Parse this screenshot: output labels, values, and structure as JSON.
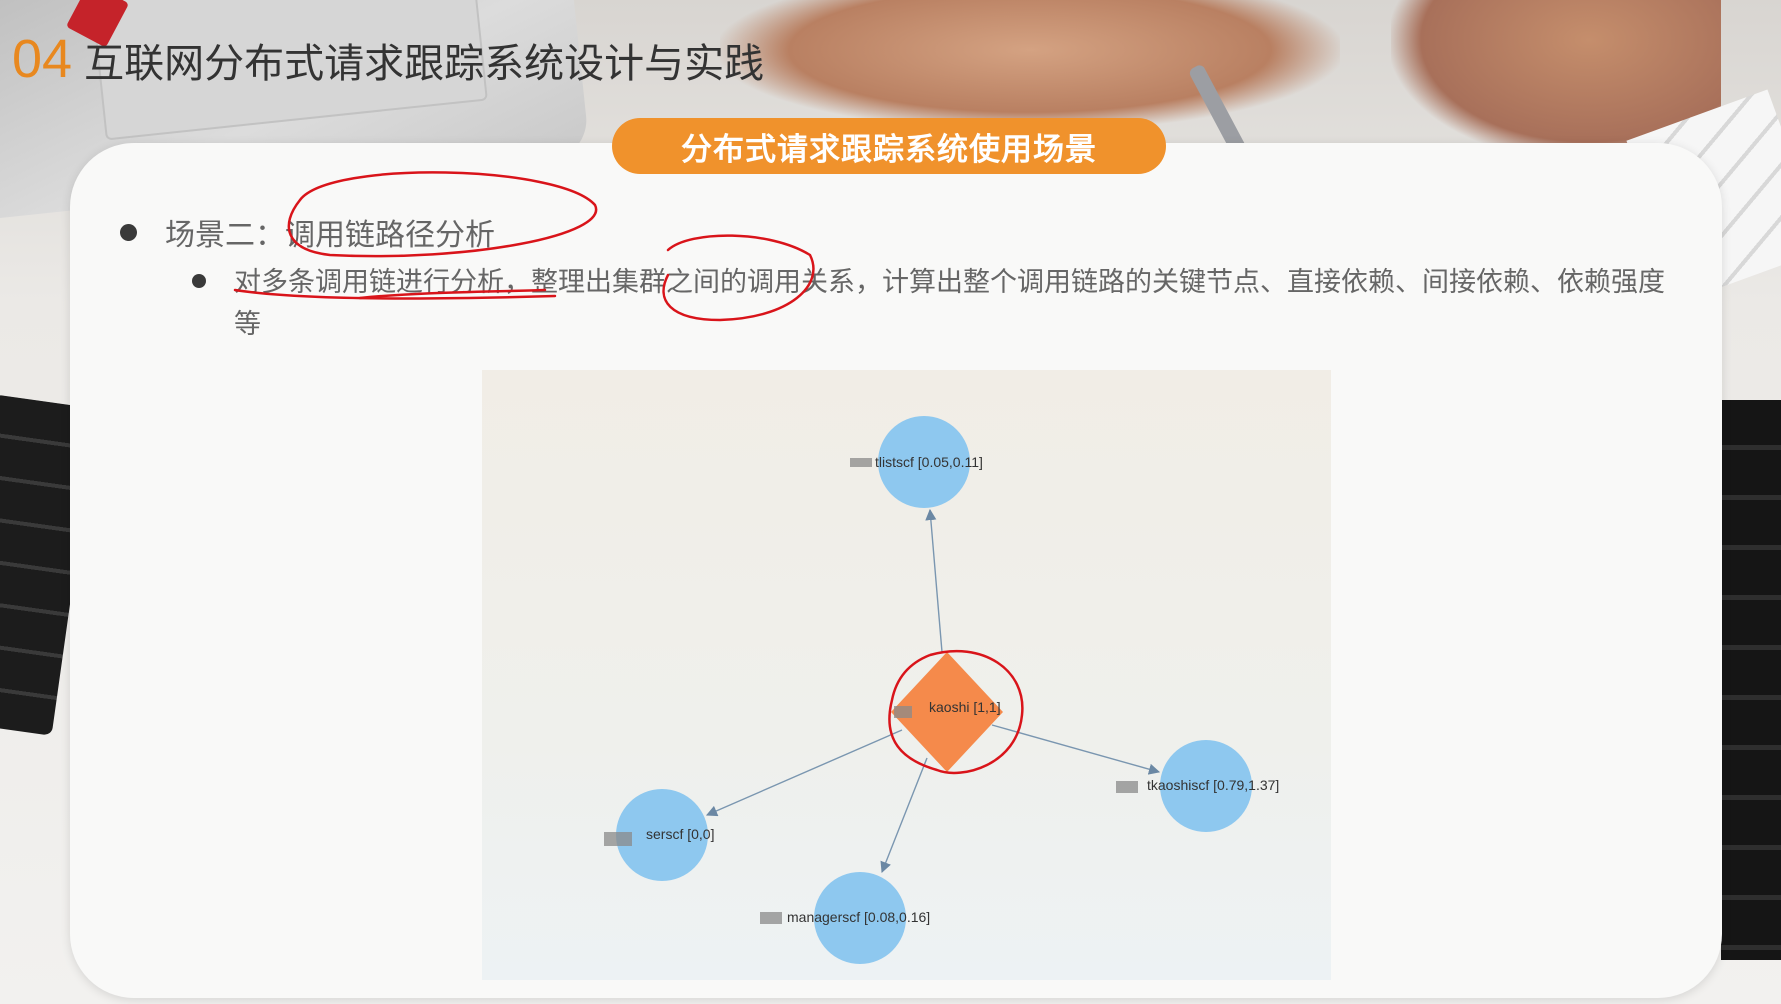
{
  "header": {
    "number": "04",
    "title": "互联网分布式请求跟踪系统设计与实践"
  },
  "pill_title": "分布式请求跟踪系统使用场景",
  "bullets": {
    "level1": "场景二：调用链路径分析",
    "level2": "对多条调用链进行分析，整理出集群之间的调用关系，计算出整个调用链路的关键节点、直接依赖、间接依赖、依赖强度等"
  },
  "colors": {
    "accent": "#f0922c",
    "header_number": "#e8881f",
    "service_node": "#8ec8ef",
    "center_node": "#f58a4b",
    "annotation": "#d9141a",
    "edge": "#7a96b0"
  },
  "diagram": {
    "center": {
      "label": "kaoshi [1,1]",
      "shape": "diamond"
    },
    "nodes": [
      {
        "label": "tlistscf [0.05,0.11]"
      },
      {
        "label": "tkaoshiscf [0.79,1.37]"
      },
      {
        "label": "serscf [0,0]"
      },
      {
        "label": "managerscf [0.08,0.16]"
      }
    ]
  }
}
